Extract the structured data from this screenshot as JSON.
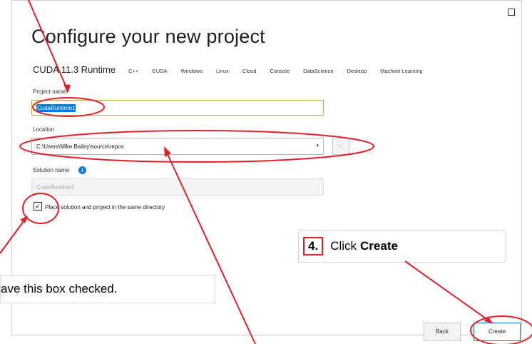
{
  "dialog": {
    "title": "Configure your new project",
    "template_name": "CUDA 11.3 Runtime",
    "tags": [
      "C++",
      "CUDA",
      "Windows",
      "Linux",
      "Cloud",
      "Console",
      "DataScience",
      "Desktop",
      "Machine Learning"
    ]
  },
  "project_name": {
    "label": "Project name",
    "value": "CudaRuntime1"
  },
  "location": {
    "label": "Location",
    "value": "C:\\Users\\Mike Bailey\\source\\repos",
    "browse_label": "..."
  },
  "solution_name": {
    "label": "Solution name",
    "value": "CudaRuntime1"
  },
  "same_directory": {
    "checked": true,
    "label": "Place solution and project in the same directory"
  },
  "buttons": {
    "back": "Back",
    "create": "Create"
  },
  "callouts": {
    "step_number": "4.",
    "click_text": "Click",
    "create_bold": "Create",
    "checkbox_note": "ave this box checked."
  },
  "colors": {
    "annotation_red": "#e0202a",
    "accent_blue": "#0078d7",
    "info_blue": "#1a73e8"
  }
}
